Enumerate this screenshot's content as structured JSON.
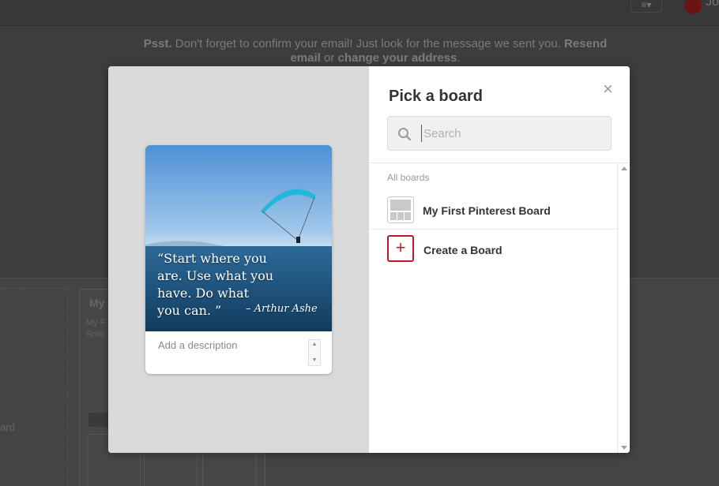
{
  "background": {
    "notice_bold": "Psst.",
    "notice_text": " Don't forget to confirm your email! Just look for the message we sent you. ",
    "notice_link1": "Resend email",
    "notice_or": " or ",
    "notice_link2": "change your address",
    "notice_end": ".",
    "menu_glyph": "≡▾",
    "user_name": "Jo",
    "board_card_title": "My",
    "board_card_sub": "My F Smit",
    "left_card_text": "ard"
  },
  "modal": {
    "title": "Pick a board",
    "close_glyph": "×",
    "search": {
      "placeholder": "Search",
      "value": ""
    },
    "section_label": "All boards",
    "boards": [
      {
        "name": "My First Pinterest Board"
      }
    ],
    "create_label": "Create a Board",
    "create_glyph": "+",
    "pin": {
      "quote": "“Start where you are. Use what you have. Do what you can. ”",
      "author": "– Arthur Ashe",
      "description_placeholder": "Add a description"
    }
  },
  "colors": {
    "accent": "#b71c2c",
    "overlay": "#3d3d3d",
    "left_pane": "#d9d9d9"
  },
  "icons": [
    "search-icon",
    "close-icon",
    "plus-icon",
    "board-thumbnail-icon",
    "scroll-up-icon",
    "scroll-down-icon"
  ]
}
